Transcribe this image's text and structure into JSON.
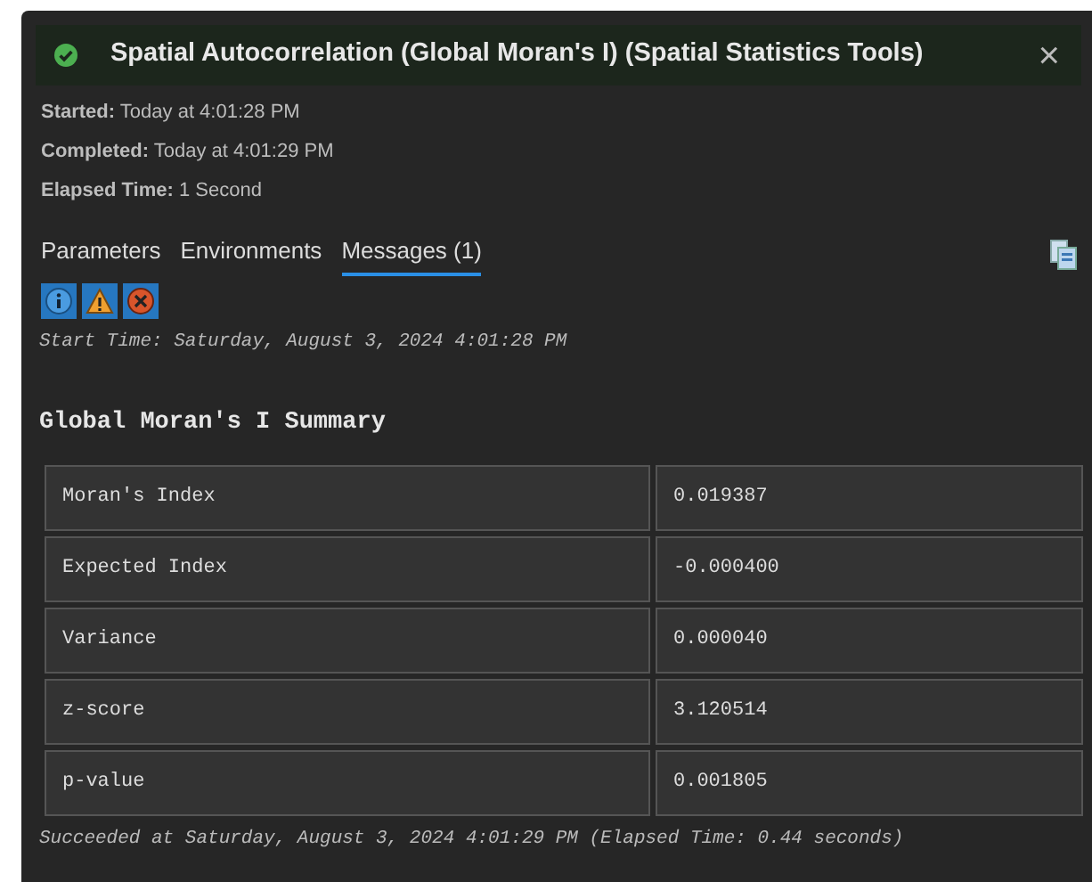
{
  "window": {
    "title": "Spatial Autocorrelation (Global Moran's I) (Spatial Statistics Tools)",
    "succeeded": true,
    "close": "×"
  },
  "info": [
    {
      "label": "Started:",
      "value": "Today at 4:01:28 PM"
    },
    {
      "label": "Completed:",
      "value": "Today at 4:01:29 PM"
    },
    {
      "label": "Elapsed Time:",
      "value": "1 Second"
    }
  ],
  "tabs": [
    {
      "label": "Parameters",
      "selected": false
    },
    {
      "label": "Environments",
      "selected": false
    },
    {
      "label": "Messages (1)",
      "selected": true
    }
  ],
  "filters": [
    {
      "kind": "info"
    },
    {
      "kind": "warning"
    },
    {
      "kind": "error"
    }
  ],
  "messages": {
    "start": "Start Time: Saturday, August 3, 2024 4:01:28 PM",
    "heading": "Global Moran's I Summary",
    "rows": [
      {
        "label": "Moran's Index",
        "value": "0.019387"
      },
      {
        "label": "Expected Index",
        "value": "-0.000400"
      },
      {
        "label": "Variance",
        "value": "0.000040"
      },
      {
        "label": "z-score",
        "value": "3.120514"
      },
      {
        "label": "p-value",
        "value": "0.001805"
      }
    ],
    "end": "Succeeded at Saturday, August 3, 2024 4:01:29 PM (Elapsed Time: 0.44 seconds)"
  }
}
